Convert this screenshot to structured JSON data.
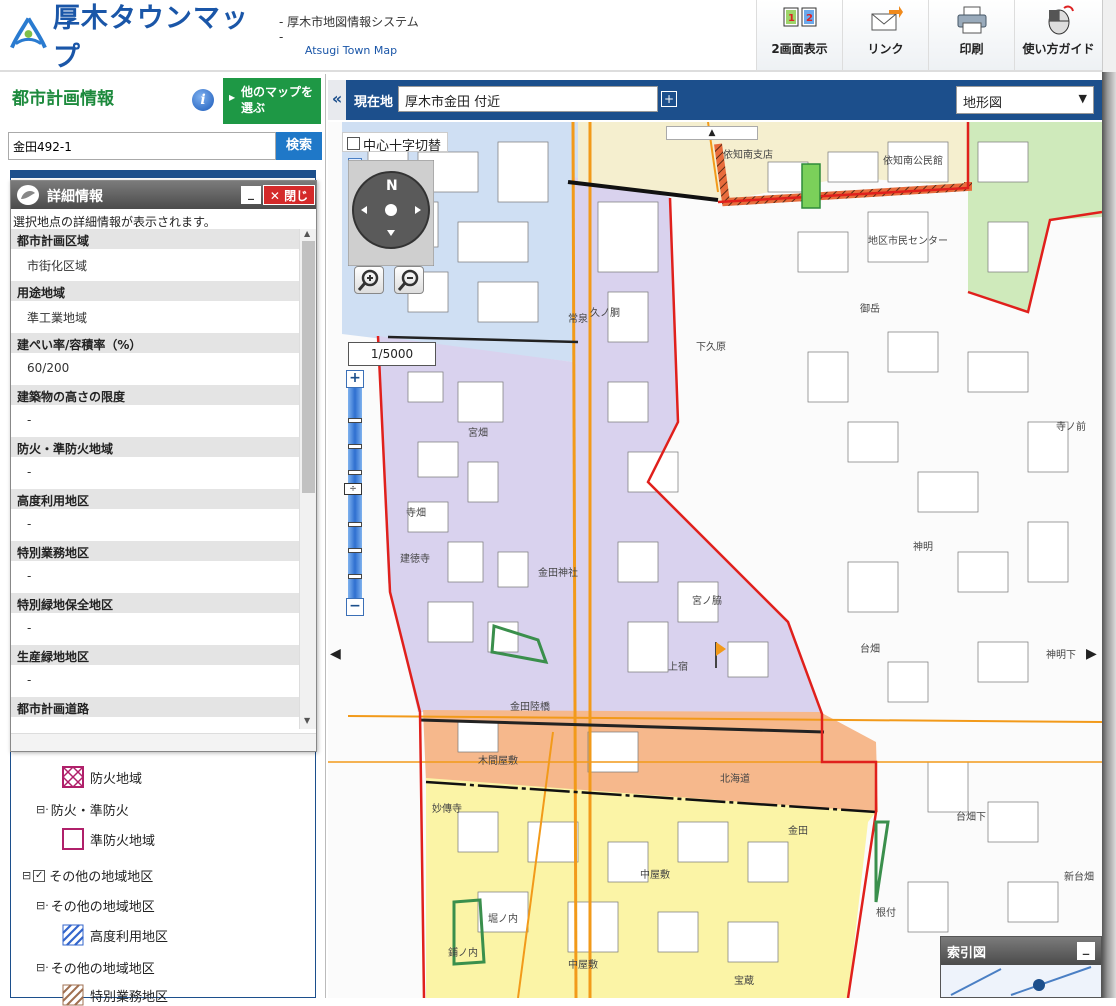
{
  "header": {
    "app_title": "厚木タウンマップ",
    "subtitle_jp": "- 厚木市地図情報システム -",
    "subtitle_en": "Atsugi Town Map",
    "tools": [
      {
        "label": "2画面表示",
        "icon": "dual-screen-icon"
      },
      {
        "label": "リンク",
        "icon": "mail-link-icon"
      },
      {
        "label": "印刷",
        "icon": "printer-icon"
      },
      {
        "label": "使い方ガイド",
        "icon": "mouse-guide-icon"
      }
    ]
  },
  "left_panel": {
    "title": "都市計画情報",
    "other_map_button": "他のマップを選ぶ",
    "search": {
      "value": "金田492-1",
      "button": "検索"
    },
    "detail": {
      "title": "詳細情報",
      "close_label": "閉じる",
      "minimize_label": "_",
      "description": "選択地点の詳細情報が表示されます。",
      "rows": [
        {
          "header": "都市計画区域",
          "value": "市街化区域"
        },
        {
          "header": "用途地域",
          "value": "準工業地域"
        },
        {
          "header": "建ぺい率/容積率（%）",
          "value": "60/200"
        },
        {
          "header": "建築物の高さの限度",
          "value": "-"
        },
        {
          "header": "防火・準防火地域",
          "value": "-"
        },
        {
          "header": "高度利用地区",
          "value": "-"
        },
        {
          "header": "特別業務地区",
          "value": "-"
        },
        {
          "header": "特別緑地保全地区",
          "value": "-"
        },
        {
          "header": "生産緑地地区",
          "value": "-"
        },
        {
          "header": "都市計画道路",
          "value": ""
        }
      ]
    },
    "tree": {
      "fire_zone": "防火地域",
      "fire_group": "防火・準防火",
      "quasi_fire_zone": "準防火地域",
      "other_districts": "その他の地域地区",
      "other_districts_sub": "その他の地域地区",
      "high_use": "高度利用地区",
      "other_districts_sub2": "その他の地域地区",
      "special_business": "特別業務地区"
    }
  },
  "mapbar": {
    "collapse": "«",
    "location_label": "現在地",
    "location_value": "厚木市金田 付近",
    "map_type": "地形図"
  },
  "map": {
    "center_toggle": "中心十字切替",
    "compass_north": "N",
    "scale": "1/5000",
    "zoom_in": "+",
    "zoom_out": "−",
    "zoom_level_fraction": 0.52,
    "labels": [
      "依知南支店",
      "依知南公民館",
      "地区市民センター",
      "下久原",
      "久ノ胴",
      "宮畑",
      "寺畑",
      "建徳寺",
      "金田神社",
      "宮ノ脇",
      "上宿",
      "御岳",
      "寺ノ前",
      "神明",
      "神明下",
      "台畑",
      "金田陸橋",
      "木間屋敷",
      "北海道",
      "金田",
      "中屋敷",
      "台畑下",
      "新台畑",
      "根付",
      "堀ノ内",
      "中屋敷",
      "宝蔵",
      "鋪ノ内",
      "妙傳寺",
      "常泉"
    ],
    "index_map": {
      "title": "索引図",
      "minimize": "_"
    }
  },
  "colors": {
    "brand_blue": "#1a56a8",
    "green_button": "#1e9845",
    "bar_blue": "#1c4f8c",
    "zone_industrial": "#d9d2ee",
    "zone_lightblue": "#cfdff3",
    "zone_orange": "#f6b88c",
    "zone_yellow": "#fbf4a6",
    "zone_green": "#cfeabb",
    "zone_cream": "#f5efcf",
    "boundary_red": "#e0201c",
    "road_orange": "#f29a1a"
  }
}
